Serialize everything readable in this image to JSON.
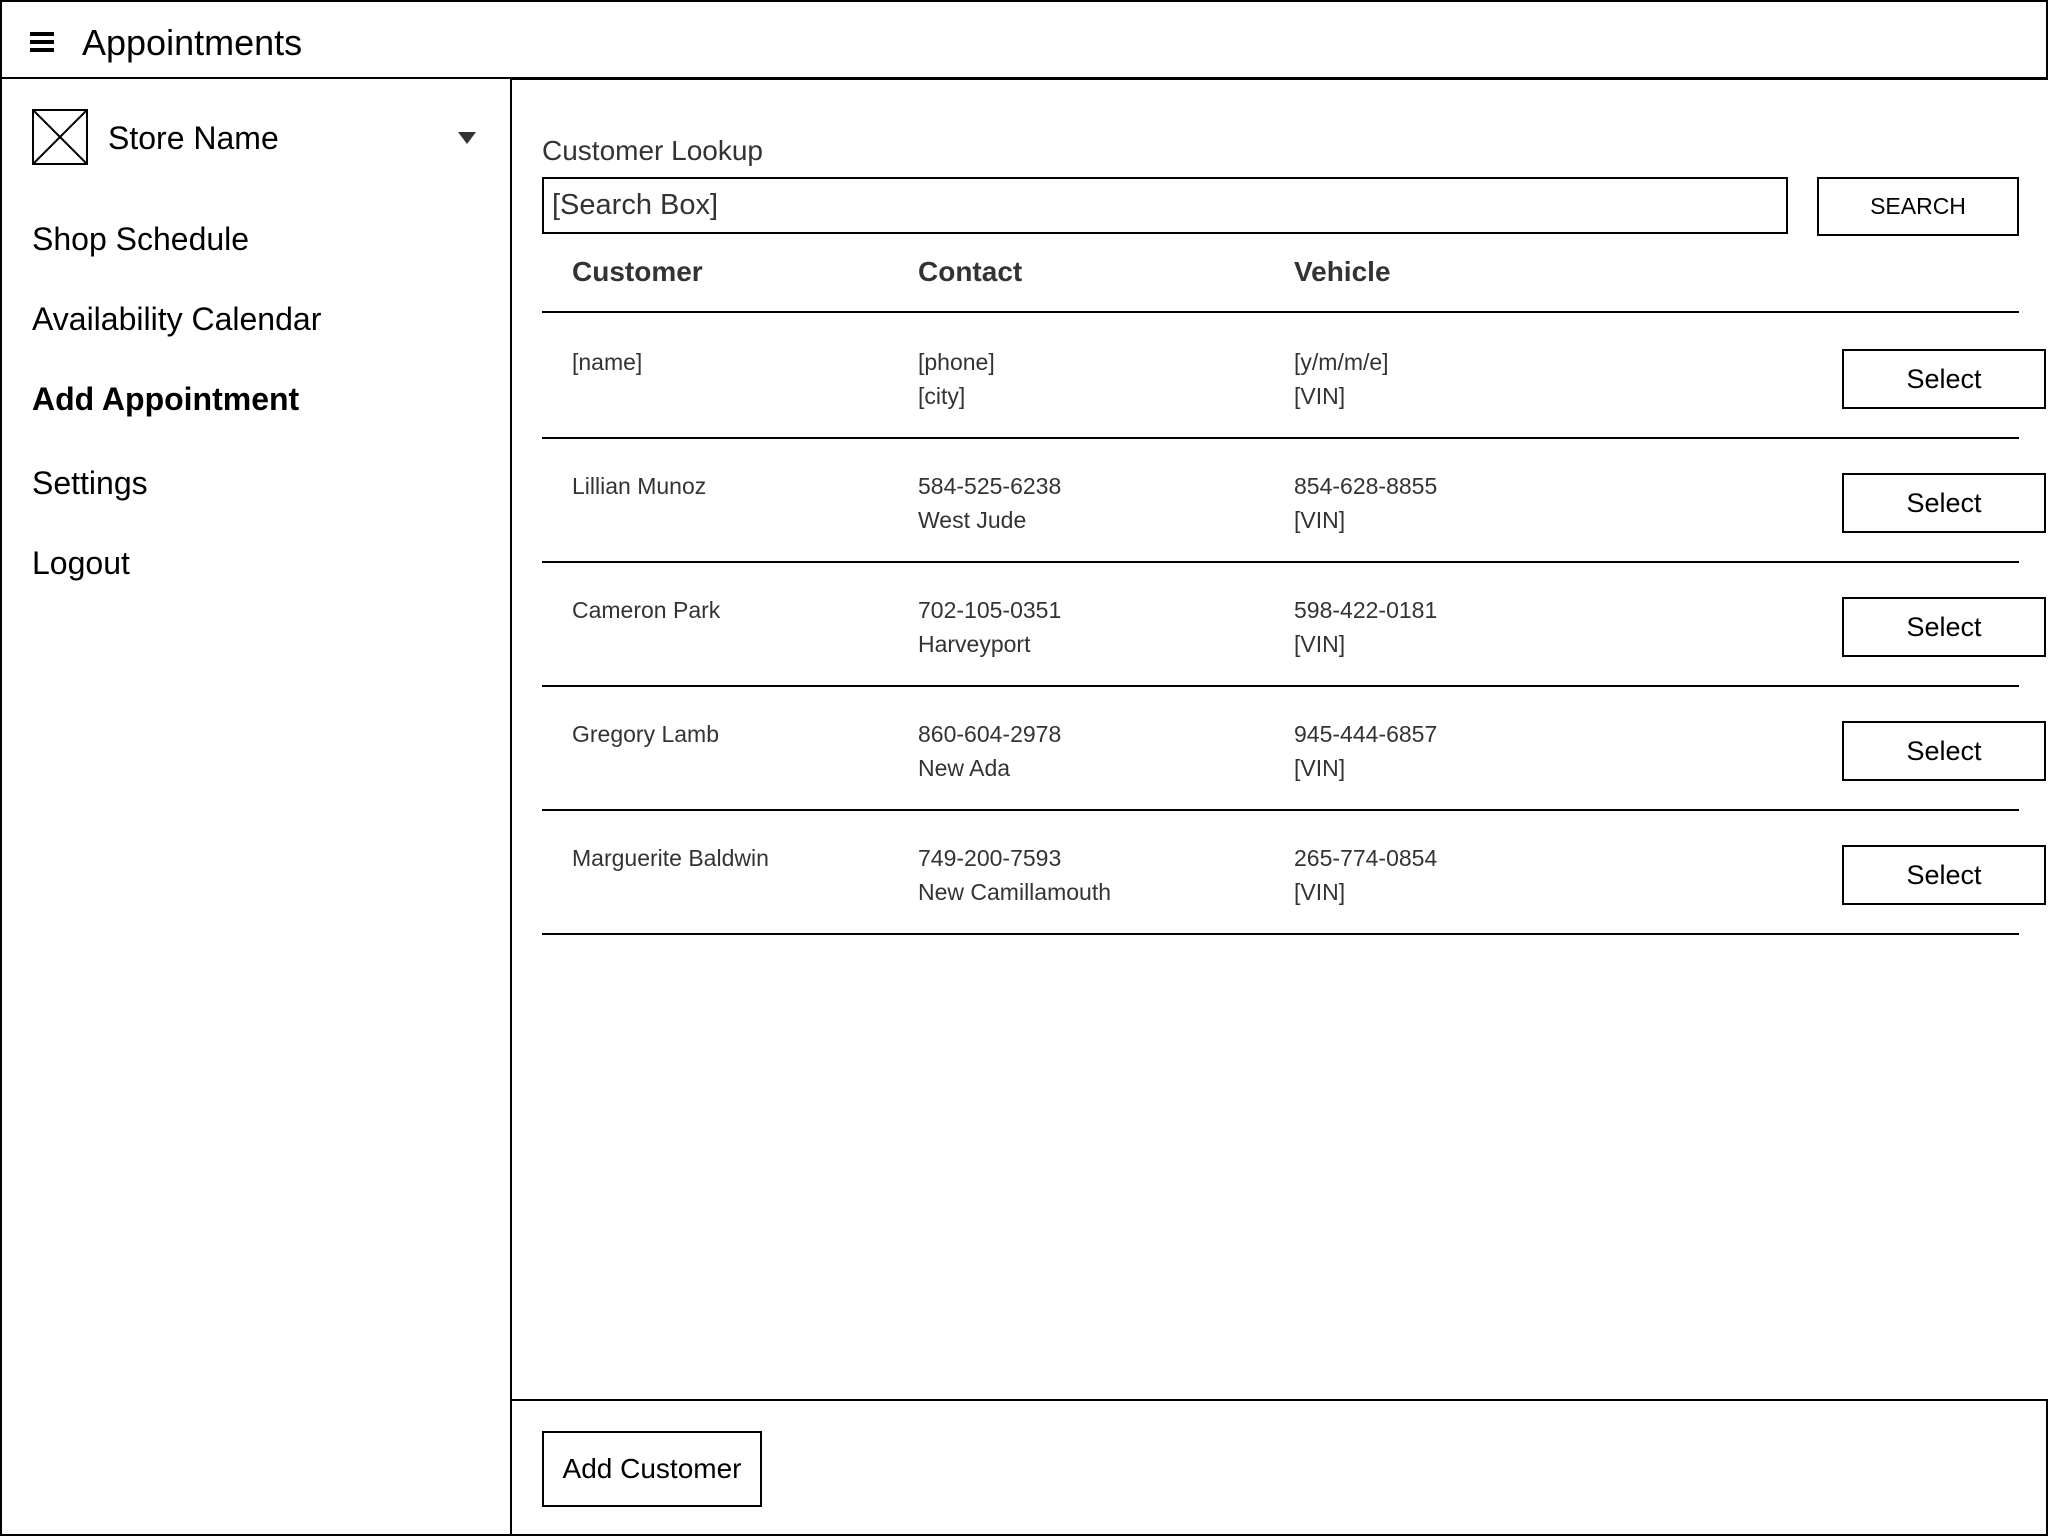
{
  "header": {
    "title": "Appointments",
    "menu_icon": "hamburger-menu-icon"
  },
  "sidebar": {
    "store": {
      "name": "Store Name",
      "logo_icon": "image-placeholder-icon",
      "dropdown_icon": "chevron-down-icon"
    },
    "items": [
      {
        "label": "Shop Schedule",
        "active": false
      },
      {
        "label": "Availability Calendar",
        "active": false
      },
      {
        "label": "Add Appointment",
        "active": true
      },
      {
        "label": "Settings",
        "active": false
      },
      {
        "label": "Logout",
        "active": false
      }
    ]
  },
  "main": {
    "lookup_label": "Customer Lookup",
    "search": {
      "placeholder": "[Search Box]",
      "value": "",
      "button_label": "SEARCH"
    },
    "table": {
      "columns": [
        "Customer",
        "Contact",
        "Vehicle"
      ],
      "rows": [
        {
          "name": "[name]",
          "phone": "[phone]",
          "city": "[city]",
          "vehicle": "[y/m/m/e]",
          "vin": "[VIN]",
          "action": "Select"
        },
        {
          "name": "Lillian Munoz",
          "phone": "584-525-6238",
          "city": "West Jude",
          "vehicle": "854-628-8855",
          "vin": "[VIN]",
          "action": "Select"
        },
        {
          "name": "Cameron Park",
          "phone": "702-105-0351",
          "city": "Harveyport",
          "vehicle": "598-422-0181",
          "vin": "[VIN]",
          "action": "Select"
        },
        {
          "name": "Gregory Lamb",
          "phone": "860-604-2978",
          "city": "New Ada",
          "vehicle": "945-444-6857",
          "vin": "[VIN]",
          "action": "Select"
        },
        {
          "name": "Marguerite Baldwin",
          "phone": "749-200-7593",
          "city": "New Camillamouth",
          "vehicle": "265-774-0854",
          "vin": "[VIN]",
          "action": "Select"
        }
      ]
    }
  },
  "footer": {
    "add_customer_label": "Add Customer"
  }
}
